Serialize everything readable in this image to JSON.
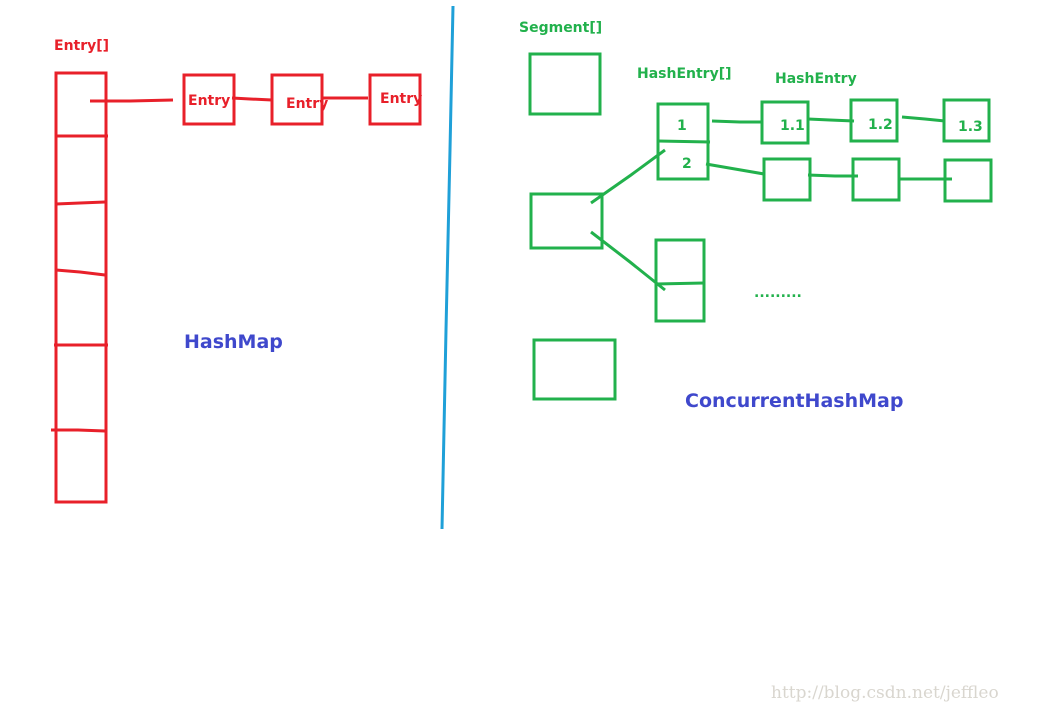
{
  "hashmap": {
    "array_label": "Entry[]",
    "entry_labels": [
      "Entry",
      "Entry",
      "Entry"
    ],
    "title": "HashMap",
    "bucket_count": 6
  },
  "concurrent": {
    "segment_label": "Segment[]",
    "hashentry_array_label": "HashEntry[]",
    "hashentry_label": "HashEntry",
    "bucket_labels": [
      "1",
      "2"
    ],
    "chain_labels": [
      "1.1",
      "1.2",
      "1.3"
    ],
    "ellipsis": ".........",
    "title": "ConcurrentHashMap"
  },
  "colors": {
    "hashmap": "#e8202a",
    "concurrent": "#22b14c",
    "divider": "#1fa0d8",
    "title": "#3f48cc"
  },
  "watermark": "http://blog.csdn.net/jeffleo"
}
